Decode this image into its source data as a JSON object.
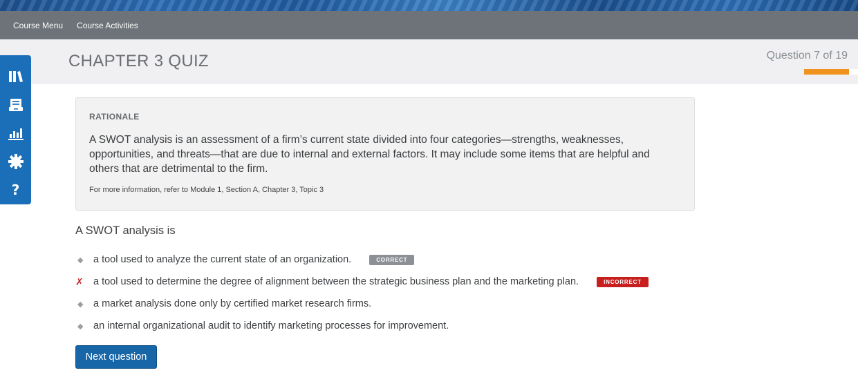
{
  "nav": {
    "course_menu": "Course Menu",
    "course_activities": "Course Activities"
  },
  "header": {
    "title": "CHAPTER 3 QUIZ",
    "progress_text": "Question 7 of 19",
    "progress": {
      "current": 7,
      "total": 19
    },
    "accent_color": "#f0921e"
  },
  "sidebar": {
    "color": "#1b6fb8",
    "icons": [
      "library-icon",
      "archive-icon",
      "bar-chart-icon",
      "gear-icon",
      "help-icon"
    ],
    "help_glyph": "?"
  },
  "rationale": {
    "heading": "RATIONALE",
    "body": "A SWOT analysis is an assessment of a firm’s current state divided into four categories—strengths, weaknesses, opportunities, and threats—that are due to internal and external factors. It may include some items that are helpful and others that are detrimental to the firm.",
    "reference": "For more information, refer to Module 1, Section A, Chapter 3, Topic 3"
  },
  "question": {
    "prompt": "A SWOT analysis is",
    "answers": [
      {
        "marker": "◆",
        "text": "a tool used to analyze the current state of an organization.",
        "badge": "CORRECT"
      },
      {
        "marker": "✗",
        "text": "a tool used to determine the degree of alignment between the strategic business plan and the marketing plan.",
        "badge": "INCORRECT"
      },
      {
        "marker": "◆",
        "text": "a market analysis done only by certified market research firms."
      },
      {
        "marker": "◆",
        "text": "an internal organizational audit to identify marketing processes for improvement."
      }
    ]
  },
  "next_button": "Next question"
}
